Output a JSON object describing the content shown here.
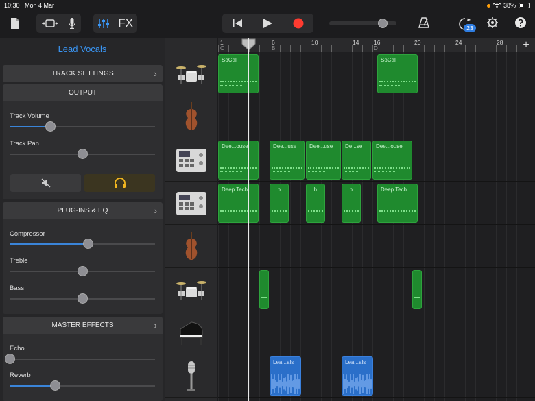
{
  "status": {
    "time": "10:30",
    "date": "Mon 4 Mar",
    "battery": "38%",
    "battery_level": 0.38
  },
  "toolbar": {
    "fx_label": "FX",
    "loop_badge": "23",
    "icons": [
      "document-icon",
      "view-toggle-icon",
      "microphone-icon",
      "mixer-icon",
      "rewind-icon",
      "play-icon",
      "record-icon",
      "metronome-icon",
      "loop-browser-icon",
      "settings-icon",
      "help-icon"
    ]
  },
  "sidebar": {
    "track_title": "Lead Vocals",
    "track_settings": "TRACK SETTINGS",
    "output": "OUTPUT",
    "plugins": "PLUG-INS & EQ",
    "master": "MASTER EFFECTS",
    "controls": {
      "track_volume": {
        "label": "Track Volume",
        "value": 0.28
      },
      "track_pan": {
        "label": "Track Pan",
        "value": 0.5
      },
      "compressor": {
        "label": "Compressor",
        "value": 0.54
      },
      "treble": {
        "label": "Treble",
        "value": 0.5
      },
      "bass": {
        "label": "Bass",
        "value": 0.5
      },
      "echo": {
        "label": "Echo",
        "value": 0.0
      },
      "reverb": {
        "label": "Reverb",
        "value": 0.31
      }
    }
  },
  "ruler": {
    "bars": [
      {
        "num": "1",
        "sec": "C"
      },
      {
        "num": "6",
        "sec": "B"
      },
      {
        "num": "10",
        "sec": ""
      },
      {
        "num": "14",
        "sec": ""
      },
      {
        "num": "16",
        "sec": "D"
      },
      {
        "num": "20",
        "sec": ""
      },
      {
        "num": "24",
        "sec": ""
      },
      {
        "num": "28",
        "sec": ""
      }
    ]
  },
  "tracks": [
    {
      "instrument": "drum-kit-icon",
      "regions": [
        {
          "label": "SoCal",
          "color": "green"
        },
        {
          "label": "SoCal",
          "color": "green"
        }
      ]
    },
    {
      "instrument": "cello-icon",
      "regions": []
    },
    {
      "instrument": "beat-sequencer-icon",
      "regions": [
        {
          "label": "Dee...ouse",
          "color": "green"
        },
        {
          "label": "Dee...use",
          "color": "green"
        },
        {
          "label": "Dee...use",
          "color": "green"
        },
        {
          "label": "De...se",
          "color": "green"
        },
        {
          "label": "Dee...ouse",
          "color": "green"
        }
      ]
    },
    {
      "instrument": "beat-sequencer-icon",
      "regions": [
        {
          "label": "Deep Tech",
          "color": "green"
        },
        {
          "label": "...h",
          "color": "green"
        },
        {
          "label": "...h",
          "color": "green"
        },
        {
          "label": "...h",
          "color": "green"
        },
        {
          "label": "Deep Tech",
          "color": "green"
        }
      ]
    },
    {
      "instrument": "cello-icon",
      "regions": []
    },
    {
      "instrument": "drum-kit-icon",
      "regions": [
        {
          "label": "",
          "color": "green"
        },
        {
          "label": "",
          "color": "green"
        }
      ]
    },
    {
      "instrument": "grand-piano-icon",
      "regions": []
    },
    {
      "instrument": "microphone-icon",
      "regions": [
        {
          "label": "Lea...als",
          "color": "blue"
        },
        {
          "label": "Lea...als",
          "color": "blue"
        }
      ]
    }
  ]
}
